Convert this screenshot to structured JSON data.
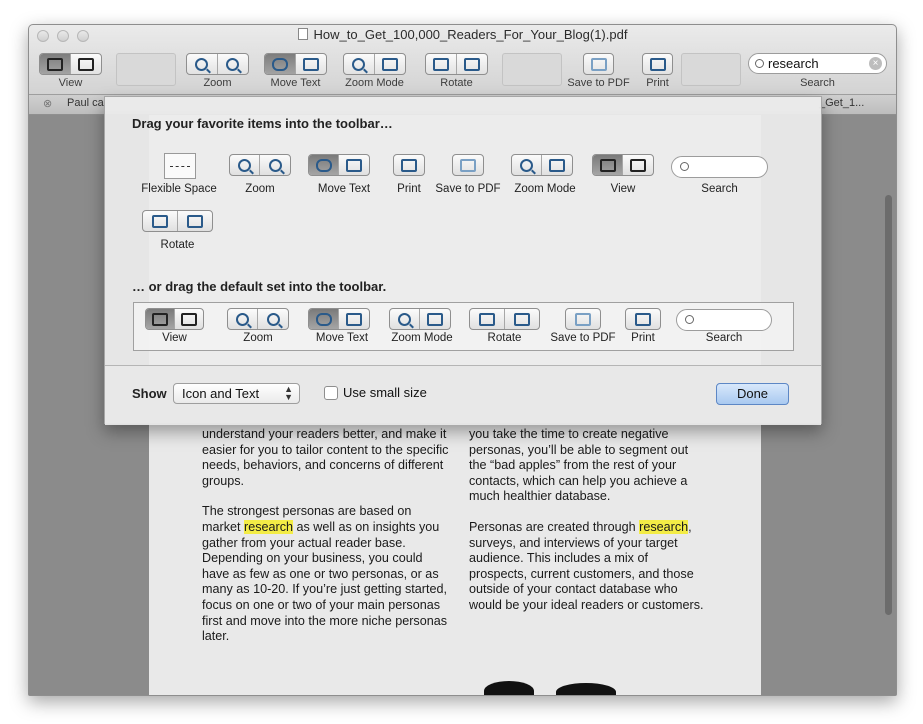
{
  "window": {
    "title": "How_to_Get_100,000_Readers_For_Your_Blog(1).pdf",
    "toolbar_labels": {
      "view": "View",
      "zoom": "Zoom",
      "move_text": "Move Text",
      "zoom_mode": "Zoom Mode",
      "rotate": "Rotate",
      "save_to_pdf": "Save to PDF",
      "print": "Print",
      "search": "Search"
    },
    "search_value": "research"
  },
  "tabs": {
    "left": "Paul ca",
    "right": "_Get_1..."
  },
  "document": {
    "left_column": [
      "understand your readers better, and make it easier for you to tailor content to the specific needs, behaviors, and concerns of different groups.",
      [
        "The strongest personas are based on market ",
        "research",
        " as well as on insights you gather from your actual reader base. Depending on your business, you could have as few as one or two personas, or as many as 10-20. If you’re just getting started, focus on one or two of your main personas first and move into the more niche personas later."
      ]
    ],
    "right_column": [
      "you take the time to create negative personas, you’ll be able to segment out the “bad apples” from the rest of your contacts, which can help you achieve a much healthier database.",
      [
        "Personas are created through ",
        "research",
        ", surveys, and interviews of your target audience. This includes a mix of prospects, current customers, and those outside of your contact database who would be your ideal readers or customers."
      ]
    ]
  },
  "customize_sheet": {
    "heading": "Drag your favorite items into the toolbar…",
    "items": {
      "flexible_space": "Flexible Space",
      "zoom": "Zoom",
      "move_text": "Move Text",
      "print": "Print",
      "save_to_pdf": "Save to PDF",
      "zoom_mode": "Zoom Mode",
      "view": "View",
      "search": "Search",
      "rotate": "Rotate"
    },
    "default_heading": "… or drag the default set into the toolbar.",
    "default_labels": {
      "view": "View",
      "zoom": "Zoom",
      "move_text": "Move Text",
      "zoom_mode": "Zoom Mode",
      "rotate": "Rotate",
      "save_to_pdf": "Save to PDF",
      "print": "Print",
      "search": "Search"
    },
    "show_label": "Show",
    "show_select": "Icon and Text",
    "small_size_label": "Use small size",
    "done_label": "Done"
  },
  "colors": {
    "highlight": "#f3ec46",
    "done_button": "#a9c9f0",
    "selected_segment": "#8a8a8a"
  }
}
